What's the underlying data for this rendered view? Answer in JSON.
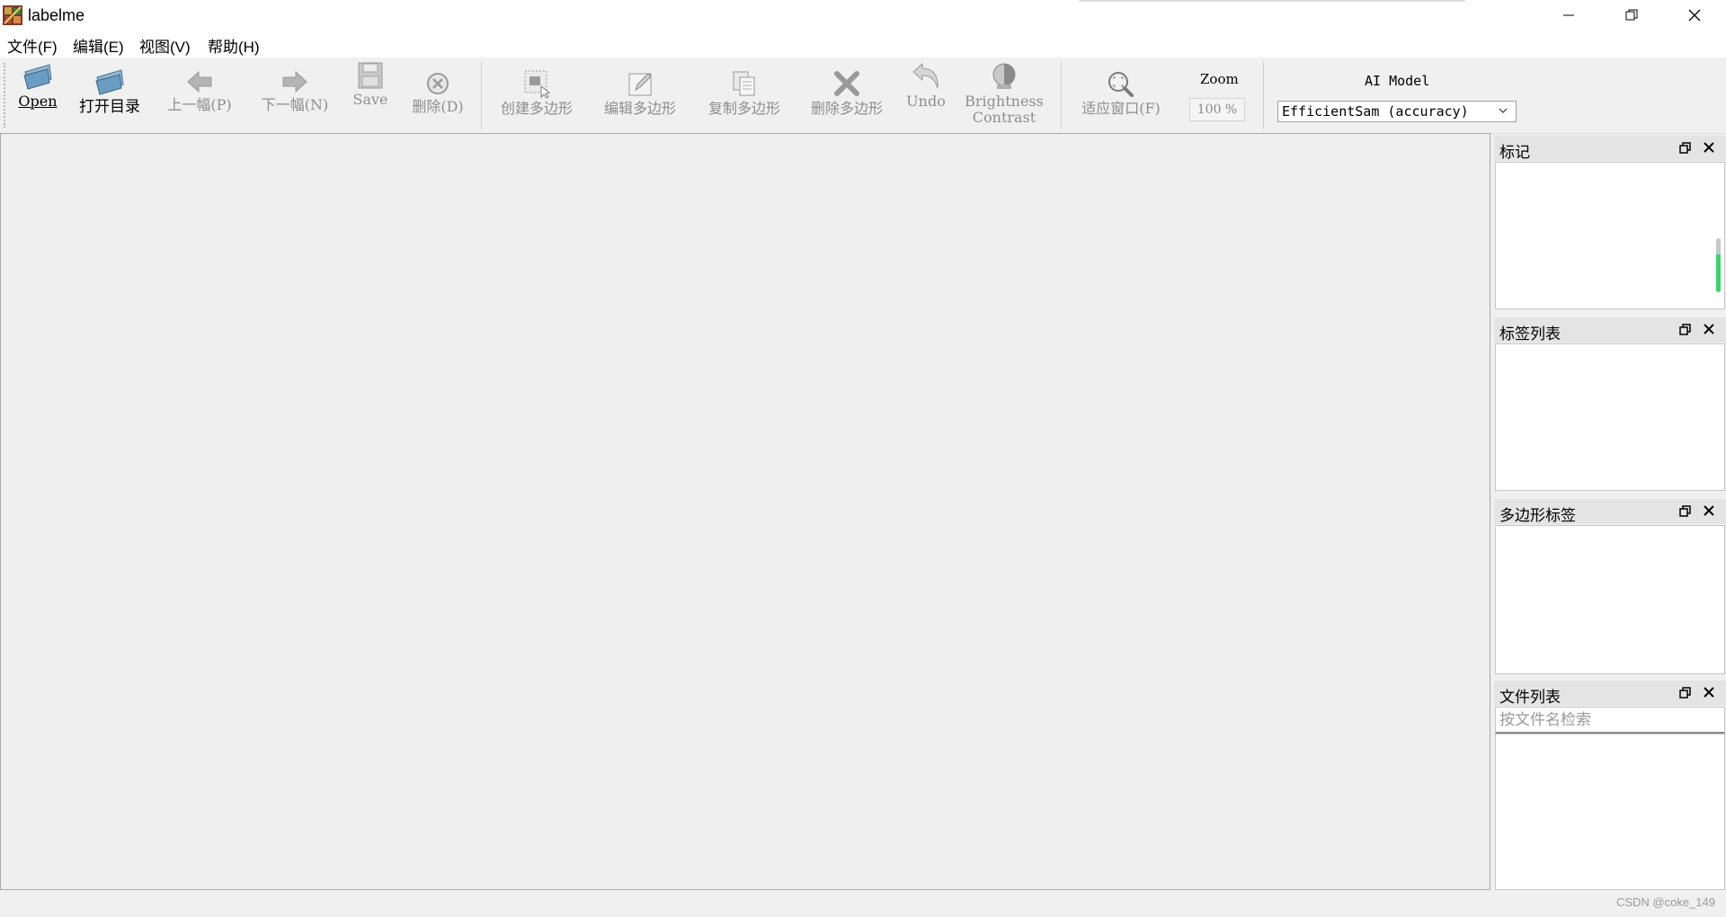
{
  "window": {
    "title": "labelme"
  },
  "menu": [
    "文件(F)",
    "编辑(E)",
    "视图(V)",
    "帮助(H)"
  ],
  "toolbar": {
    "open": "Open",
    "open_dir": "打开目录",
    "prev": "上一幅(P)",
    "next": "下一幅(N)",
    "save": "Save",
    "delete_file": "删除(D)",
    "create_polygon": "创建多边形",
    "edit_polygon": "编辑多边形",
    "copy_polygon": "复制多边形",
    "delete_polygon": "删除多边形",
    "undo": "Undo",
    "brightness_line1": "Brightness",
    "brightness_line2": "Contrast",
    "fit_window": "适应窗口(F)",
    "zoom_label": "Zoom",
    "zoom_value": "100 %",
    "ai_model_label": "AI Model",
    "ai_model_selected": "EfficientSam (accuracy)"
  },
  "docks": {
    "flags": "标记",
    "label_list": "标签列表",
    "polygon_labels": "多边形标签",
    "file_list": "文件列表",
    "file_search_placeholder": "按文件名检索"
  },
  "status": {
    "watermark": "CSDN @coke_149"
  },
  "colors": {
    "accent_scroll": "#3ed26e"
  }
}
